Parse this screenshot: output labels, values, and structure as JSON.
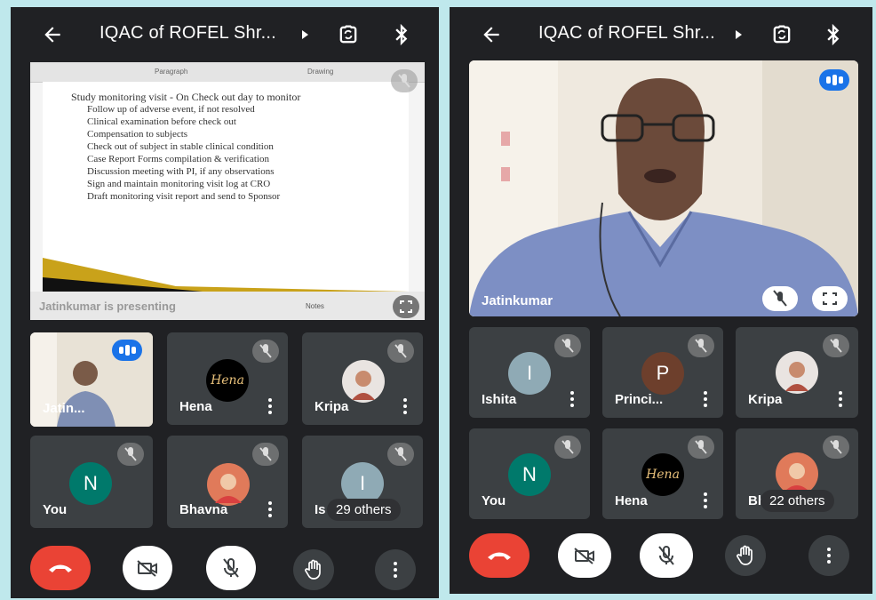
{
  "colors": {
    "background": "#202124",
    "tile": "#3c4043",
    "end_call": "#ea4335",
    "speaking": "#1a73e8",
    "frame": "#bfe8ec"
  },
  "left": {
    "title": "IQAC of ROFEL Shr...",
    "presentation": {
      "ribbon": [
        "Paragraph",
        "Drawing"
      ],
      "bullets": [
        "Study monitoring visit - On Check out day to monitor",
        "Follow up of adverse event, if not resolved",
        "Clinical examination before check out",
        "Compensation to subjects",
        "Check out of subject in stable clinical condition",
        "Case Report Forms compilation & verification",
        "Discussion meeting with PI, if any observations",
        "Sign and maintain monitoring visit log at CRO",
        "Draft monitoring visit report and send to Sponsor"
      ],
      "presenting_label": "Jatinkumar is presenting",
      "status_notes": "Notes"
    },
    "tiles": [
      {
        "name": "Jatin..."
      },
      {
        "name": "Hena",
        "avatar_text": "Hena"
      },
      {
        "name": "Kripa"
      },
      {
        "name": "You",
        "initial": "N"
      },
      {
        "name": "Bhavna"
      },
      {
        "name": "Is",
        "initial": "I",
        "others": "29 others"
      }
    ]
  },
  "right": {
    "title": "IQAC of ROFEL Shr...",
    "main_name": "Jatinkumar",
    "tiles": [
      {
        "name": "Ishita",
        "initial": "I"
      },
      {
        "name": "Princi...",
        "initial": "P"
      },
      {
        "name": "Kripa"
      },
      {
        "name": "You",
        "initial": "N"
      },
      {
        "name": "Hena",
        "avatar_text": "Hena"
      },
      {
        "name": "Bh",
        "others": "22 others"
      }
    ]
  },
  "icons": [
    "back-arrow-icon",
    "caret-right-icon",
    "switch-camera-icon",
    "bluetooth-icon",
    "mic-off-icon",
    "fullscreen-icon",
    "more-vert-icon",
    "end-call-icon",
    "camera-off-icon",
    "raise-hand-icon",
    "speaking-icon"
  ]
}
